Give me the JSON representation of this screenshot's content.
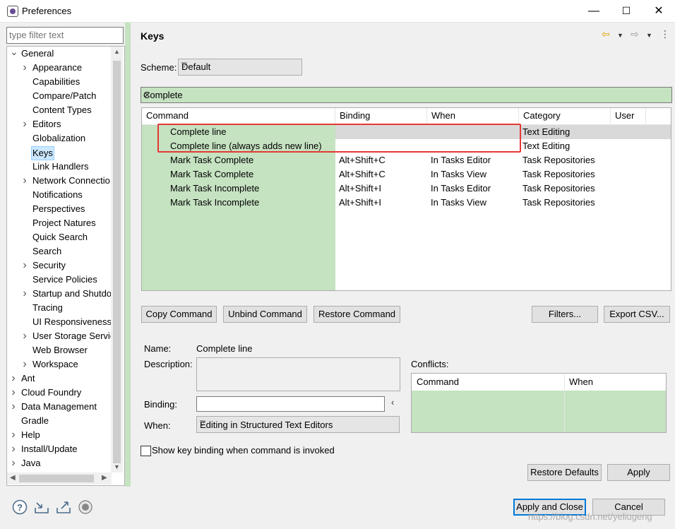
{
  "window": {
    "title": "Preferences",
    "minimize": "—",
    "maximize": "☐",
    "close": "✕"
  },
  "filter": {
    "placeholder": "type filter text"
  },
  "tree": {
    "items": [
      {
        "label": "General",
        "level": 0,
        "arrow": "down"
      },
      {
        "label": "Appearance",
        "level": 1,
        "arrow": "right"
      },
      {
        "label": "Capabilities",
        "level": 1,
        "arrow": ""
      },
      {
        "label": "Compare/Patch",
        "level": 1,
        "arrow": ""
      },
      {
        "label": "Content Types",
        "level": 1,
        "arrow": ""
      },
      {
        "label": "Editors",
        "level": 1,
        "arrow": "right"
      },
      {
        "label": "Globalization",
        "level": 1,
        "arrow": ""
      },
      {
        "label": "Keys",
        "level": 1,
        "arrow": "",
        "selected": true
      },
      {
        "label": "Link Handlers",
        "level": 1,
        "arrow": ""
      },
      {
        "label": "Network Connectio",
        "level": 1,
        "arrow": "right"
      },
      {
        "label": "Notifications",
        "level": 1,
        "arrow": ""
      },
      {
        "label": "Perspectives",
        "level": 1,
        "arrow": ""
      },
      {
        "label": "Project Natures",
        "level": 1,
        "arrow": ""
      },
      {
        "label": "Quick Search",
        "level": 1,
        "arrow": ""
      },
      {
        "label": "Search",
        "level": 1,
        "arrow": ""
      },
      {
        "label": "Security",
        "level": 1,
        "arrow": "right"
      },
      {
        "label": "Service Policies",
        "level": 1,
        "arrow": ""
      },
      {
        "label": "Startup and Shutdo",
        "level": 1,
        "arrow": "right"
      },
      {
        "label": "Tracing",
        "level": 1,
        "arrow": ""
      },
      {
        "label": "UI Responsiveness",
        "level": 1,
        "arrow": ""
      },
      {
        "label": "User Storage Servic",
        "level": 1,
        "arrow": "right"
      },
      {
        "label": "Web Browser",
        "level": 1,
        "arrow": ""
      },
      {
        "label": "Workspace",
        "level": 1,
        "arrow": "right"
      },
      {
        "label": "Ant",
        "level": 0,
        "arrow": "right"
      },
      {
        "label": "Cloud Foundry",
        "level": 0,
        "arrow": "right"
      },
      {
        "label": "Data Management",
        "level": 0,
        "arrow": "right"
      },
      {
        "label": "Gradle",
        "level": 0,
        "arrow": ""
      },
      {
        "label": "Help",
        "level": 0,
        "arrow": "right"
      },
      {
        "label": "Install/Update",
        "level": 0,
        "arrow": "right"
      },
      {
        "label": "Java",
        "level": 0,
        "arrow": "right"
      }
    ]
  },
  "page": {
    "title": "Keys",
    "scheme_label": "Scheme:",
    "scheme_value": "Default",
    "search_value": "Complete"
  },
  "table": {
    "headers": [
      "Command",
      "Binding",
      "When",
      "Category",
      "User"
    ],
    "rows": [
      {
        "command": "Complete line",
        "binding": "",
        "when": "",
        "category": "Text Editing",
        "user": ""
      },
      {
        "command": "Complete line (always adds new line)",
        "binding": "",
        "when": "",
        "category": "Text Editing",
        "user": ""
      },
      {
        "command": "Mark Task Complete",
        "binding": "Alt+Shift+C",
        "when": "In Tasks Editor",
        "category": "Task Repositories",
        "user": ""
      },
      {
        "command": "Mark Task Complete",
        "binding": "Alt+Shift+C",
        "when": "In Tasks View",
        "category": "Task Repositories",
        "user": ""
      },
      {
        "command": "Mark Task Incomplete",
        "binding": "Alt+Shift+I",
        "when": "In Tasks Editor",
        "category": "Task Repositories",
        "user": ""
      },
      {
        "command": "Mark Task Incomplete",
        "binding": "Alt+Shift+I",
        "when": "In Tasks View",
        "category": "Task Repositories",
        "user": ""
      }
    ]
  },
  "buttons": {
    "copy_command": "Copy Command",
    "unbind_command": "Unbind Command",
    "restore_command": "Restore Command",
    "filters": "Filters...",
    "export_csv": "Export CSV...",
    "restore_defaults": "Restore Defaults",
    "apply": "Apply",
    "apply_close": "Apply and Close",
    "cancel": "Cancel"
  },
  "details": {
    "name_label": "Name:",
    "name_value": "Complete line",
    "description_label": "Description:",
    "binding_label": "Binding:",
    "binding_value": "",
    "when_label": "When:",
    "when_value": "Editing in Structured Text Editors",
    "conflicts_label": "Conflicts:",
    "conflicts_headers": [
      "Command",
      "When"
    ],
    "show_binding_label": "Show key binding when command is invoked"
  },
  "watermark": "https://blog.csdn.net/yeliugeng",
  "colors": {
    "green": "#c5e2c1",
    "selection": "#cce8ff",
    "highlight_box": "#e53935"
  }
}
